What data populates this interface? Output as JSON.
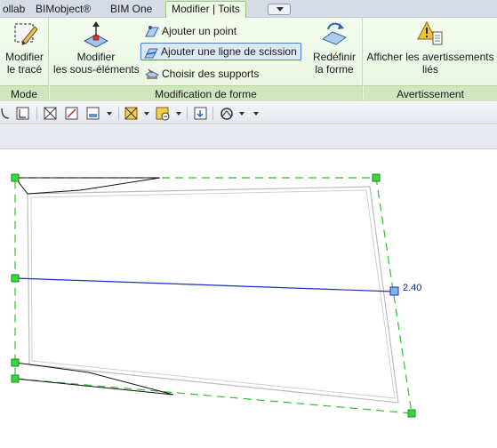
{
  "tabs": [
    {
      "label": "ollab",
      "active": false
    },
    {
      "label": "BIMobject®",
      "active": false
    },
    {
      "label": "BIM One",
      "active": false
    },
    {
      "label": "Modifier | Toits",
      "active": true
    }
  ],
  "ribbon": {
    "mode_panel": {
      "title": "Mode",
      "edit_sketch": {
        "label_line1": "Modifier",
        "label_line2": "le tracé",
        "icon": "edit-sketch-icon"
      }
    },
    "shape_panel": {
      "title": "Modification de forme",
      "modify_subelements": {
        "label_line1": "Modifier",
        "label_line2": "les sous-éléments",
        "icon": "modify-subelements-icon"
      },
      "add_point": {
        "label": "Ajouter un point",
        "icon": "add-point-icon"
      },
      "add_split_line": {
        "label": "Ajouter une ligne de scission",
        "icon": "add-split-line-icon",
        "selected": true
      },
      "pick_supports": {
        "label": "Choisir des supports",
        "icon": "pick-supports-icon"
      },
      "reset_shape": {
        "label_line1": "Redéfinir",
        "label_line2": "la forme",
        "icon": "reset-shape-icon"
      }
    },
    "warning_panel": {
      "title": "Avertissement",
      "show_warnings": {
        "label_line1": "Afficher les avertissements",
        "label_line2": "liés",
        "icon": "warning-icon"
      }
    }
  },
  "canvas": {
    "split_line_elevation": "2.40",
    "colors": {
      "grip": "#38d838",
      "grip_border": "#1a8a1a",
      "dashed_boundary": "#2ec12e",
      "split_line": "#1f2fbf",
      "roof_edge": "#b8b8b8",
      "overhang": "#000000"
    }
  },
  "colors": {
    "ribbon_bg": "#eaf6e2",
    "panel_title_bg": "#cfe6be",
    "active_tab_bg": "#eef8e6",
    "selected_button_border": "#4d7fc4"
  }
}
